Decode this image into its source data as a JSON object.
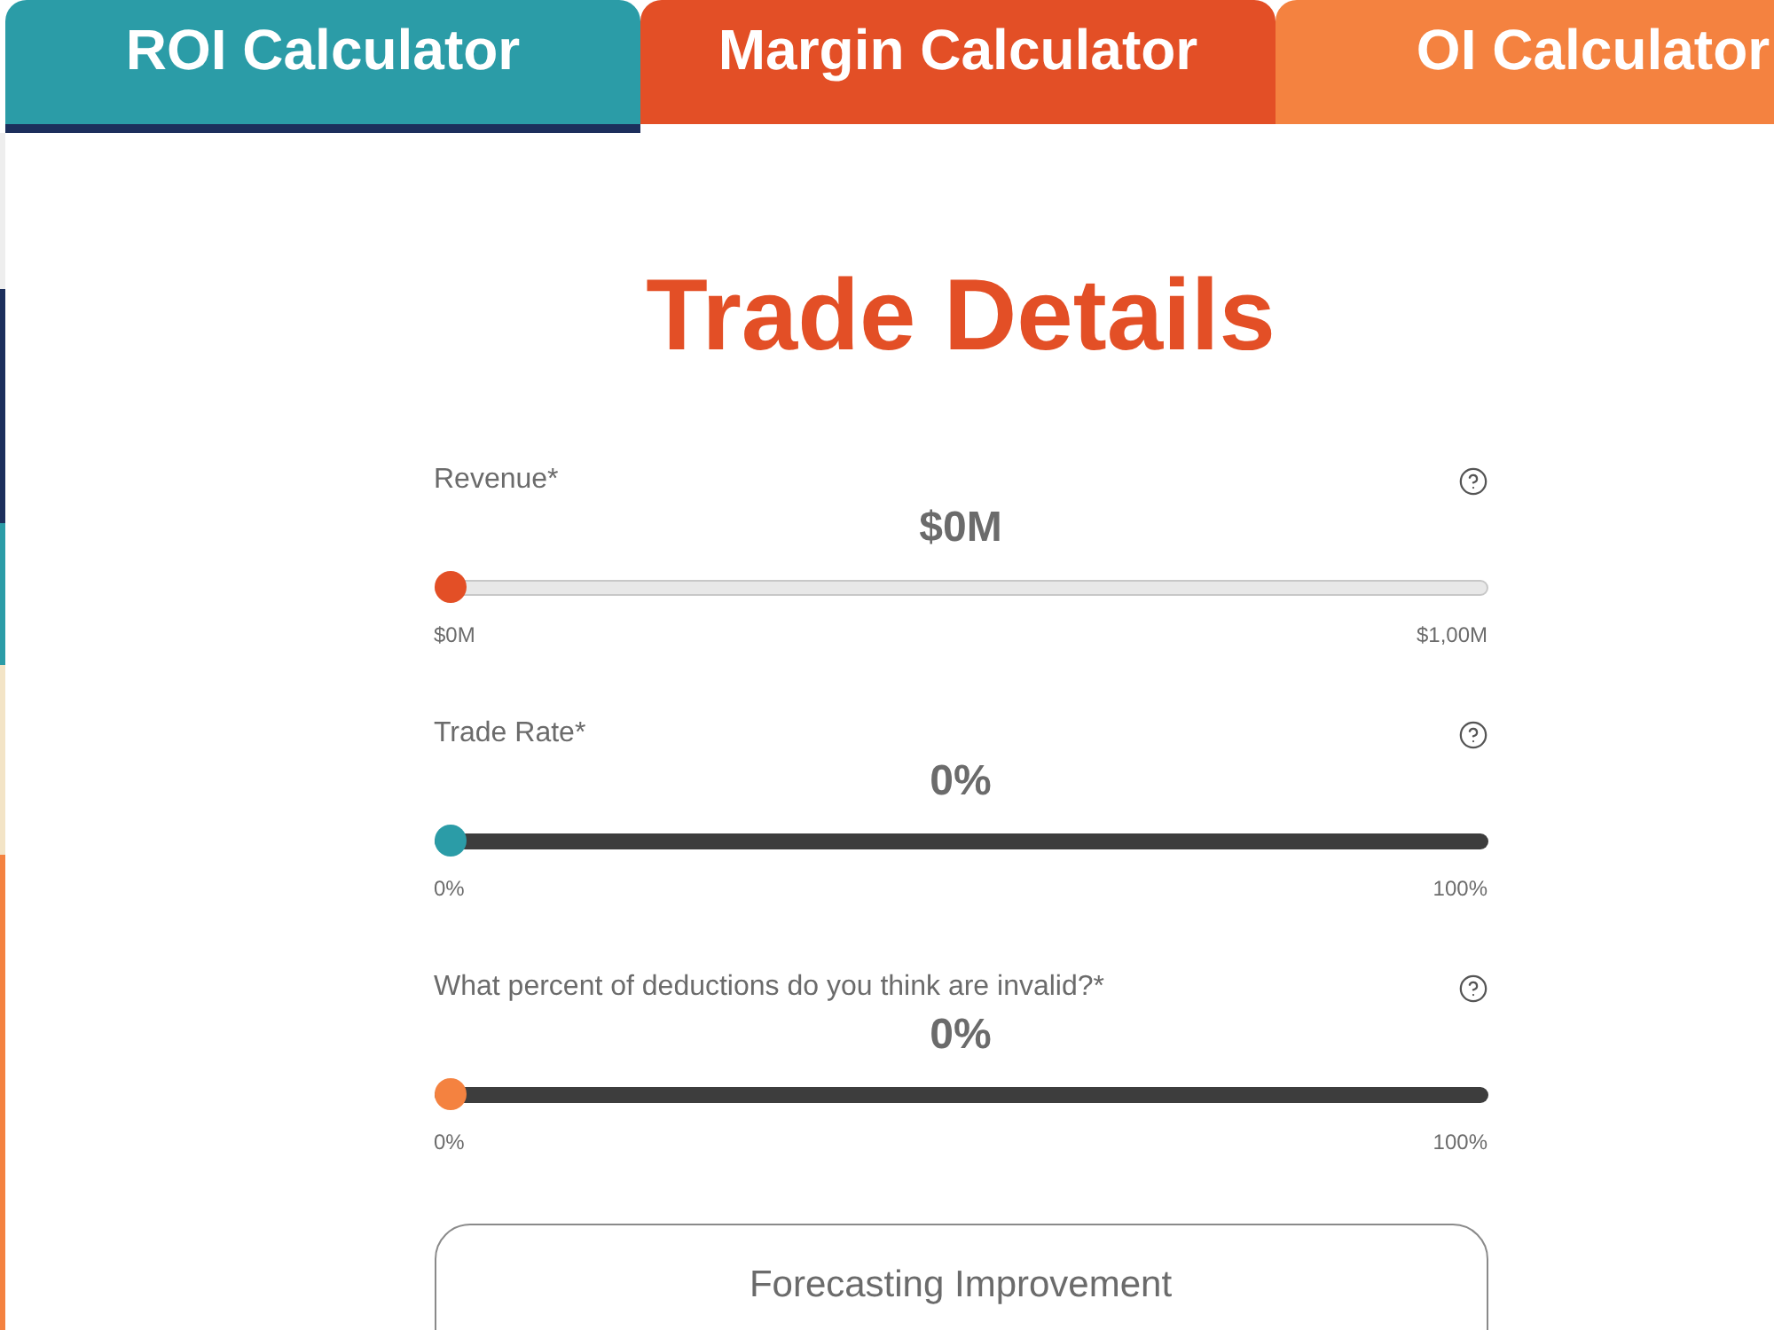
{
  "tabs": [
    {
      "label": "ROI Calculator",
      "selected": true,
      "color": "#2b9ca7"
    },
    {
      "label": "Margin Calculator",
      "selected": false,
      "color": "#e34f26"
    },
    {
      "label": "OI Calculator",
      "selected": false,
      "color": "#f48240"
    }
  ],
  "title": "Trade Details",
  "sliders": [
    {
      "kind": "light",
      "label": "Revenue*",
      "value": "$0M",
      "level": 0,
      "color": "#e34f26",
      "min_label": "$0M",
      "max_label": "$1,00M"
    },
    {
      "kind": "dark",
      "label": "Trade Rate*",
      "value": "0%",
      "level": 0,
      "color": "#2b9ca7",
      "min_label": "0%",
      "max_label": "100%"
    },
    {
      "kind": "dark",
      "label": "What percent of deductions do you think are invalid?*",
      "value": "0%",
      "level": 0,
      "color": "#f48240",
      "min_label": "0%",
      "max_label": "100%"
    }
  ],
  "forecasting_box": {
    "title": "Forecasting Improvement"
  }
}
